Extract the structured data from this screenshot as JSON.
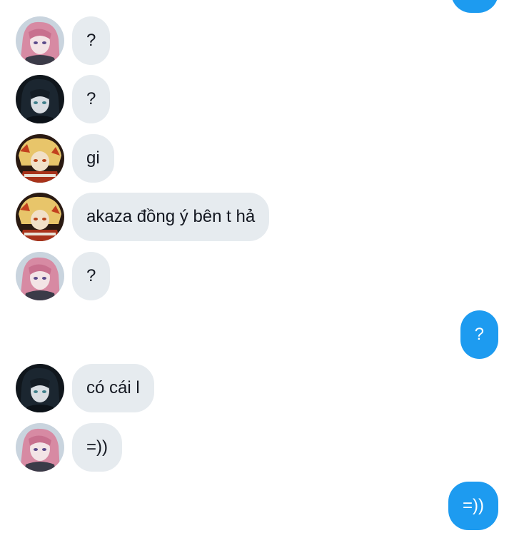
{
  "conversation": {
    "messages": [
      {
        "sender": "pink-hair",
        "direction": "incoming",
        "text": "?"
      },
      {
        "sender": "dark-hair",
        "direction": "incoming",
        "text": "?"
      },
      {
        "sender": "blond-flame",
        "direction": "incoming",
        "text": "gi"
      },
      {
        "sender": "blond-flame",
        "direction": "incoming",
        "text": "akaza đồng ý bên t hả"
      },
      {
        "sender": "pink-hair",
        "direction": "incoming",
        "text": "?"
      },
      {
        "sender": "self",
        "direction": "outgoing",
        "text": "?"
      },
      {
        "sender": "dark-hair",
        "direction": "incoming",
        "text": "có cái l"
      },
      {
        "sender": "pink-hair",
        "direction": "incoming",
        "text": "=))"
      },
      {
        "sender": "self",
        "direction": "outgoing",
        "text": "=))"
      }
    ]
  },
  "colors": {
    "incoming_bubble": "#e6ebef",
    "outgoing_bubble": "#1d9bf0",
    "incoming_text": "#141821",
    "outgoing_text": "#ffffff"
  }
}
